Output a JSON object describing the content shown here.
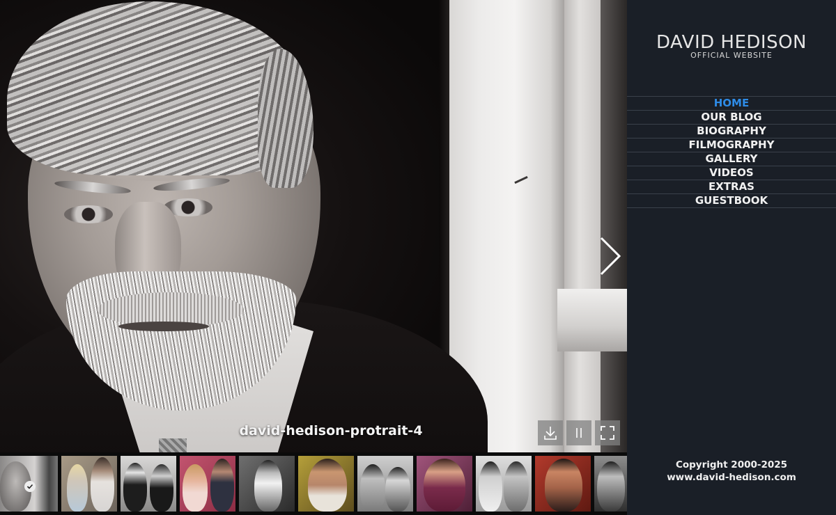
{
  "site": {
    "title": "DAVID HEDISON",
    "subtitle": "OFFICIAL WEBSITE"
  },
  "nav": {
    "items": [
      {
        "label": "HOME",
        "active": true
      },
      {
        "label": "OUR BLOG",
        "active": false
      },
      {
        "label": "BIOGRAPHY",
        "active": false
      },
      {
        "label": "FILMOGRAPHY",
        "active": false
      },
      {
        "label": "GALLERY",
        "active": false
      },
      {
        "label": "VIDEOS",
        "active": false
      },
      {
        "label": "EXTRAS",
        "active": false
      },
      {
        "label": "GUESTBOOK",
        "active": false
      }
    ]
  },
  "slideshow": {
    "caption": "david-hedison-protrait-4",
    "controls": {
      "download_icon": "download-icon",
      "pause_icon": "pause-icon",
      "fullscreen_icon": "fullscreen-icon",
      "next_icon": "chevron-right-icon"
    }
  },
  "footer": {
    "copyright": "Copyright 2000-2025",
    "url": "www.david-hedison.com"
  },
  "colors": {
    "sidebar_bg": "#1a1f27",
    "active_nav": "#2e8be6",
    "nav_text": "#f1f1f1"
  }
}
